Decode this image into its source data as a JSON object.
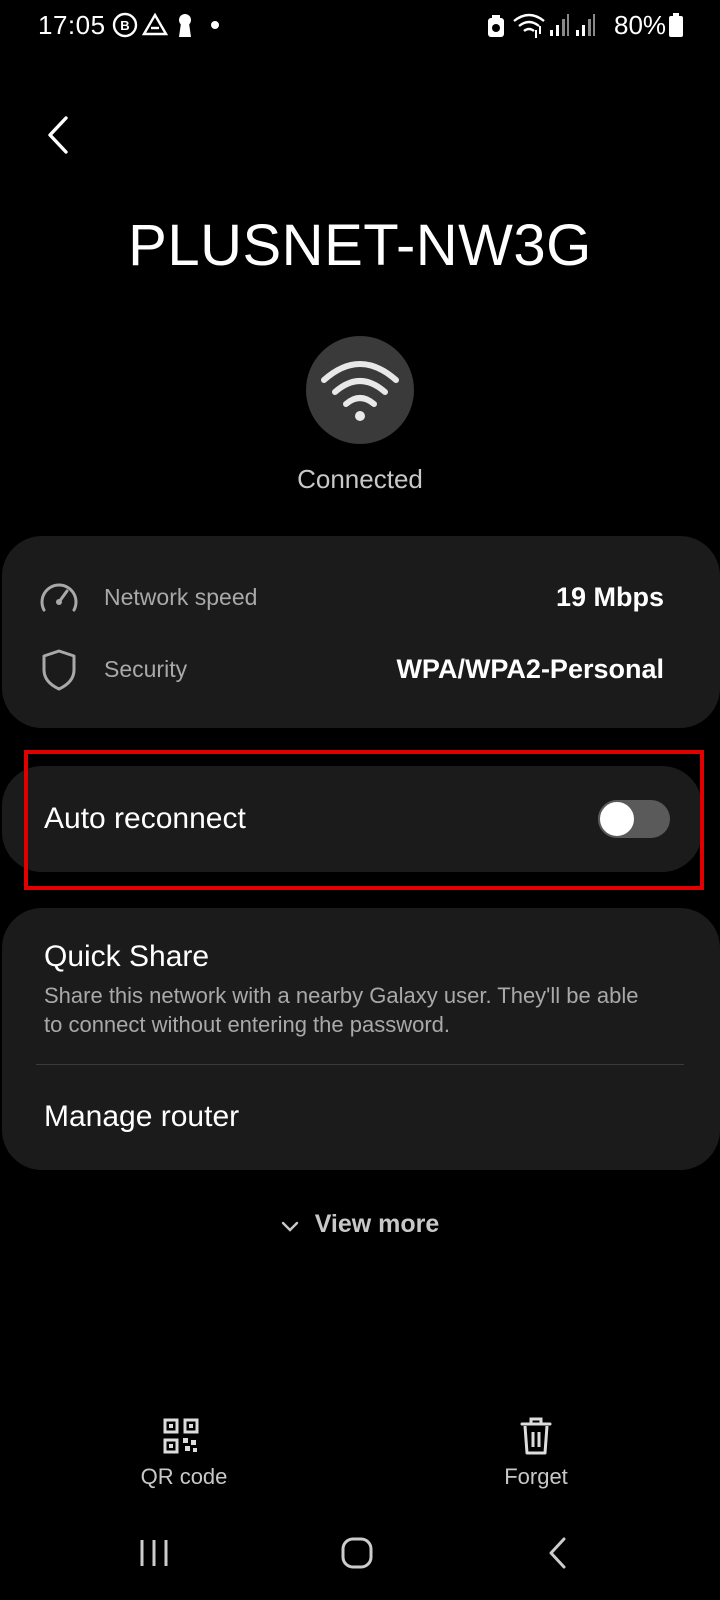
{
  "status_bar": {
    "time": "17:05",
    "battery": "80%"
  },
  "header": {
    "network_name": "PLUSNET-NW3G",
    "connection_status": "Connected"
  },
  "info": {
    "speed_label": "Network speed",
    "speed_value": "19 Mbps",
    "security_label": "Security",
    "security_value": "WPA/WPA2-Personal"
  },
  "auto_reconnect": {
    "label": "Auto reconnect",
    "enabled": false
  },
  "quick_share": {
    "title": "Quick Share",
    "description": "Share this network with a nearby Galaxy user. They'll be able to connect without entering the password."
  },
  "manage_router": {
    "label": "Manage router"
  },
  "view_more": "View more",
  "bottom_actions": {
    "qr_label": "QR code",
    "forget_label": "Forget"
  },
  "colors": {
    "background": "#000000",
    "card": "#1b1b1b",
    "highlight": "#e00000"
  }
}
